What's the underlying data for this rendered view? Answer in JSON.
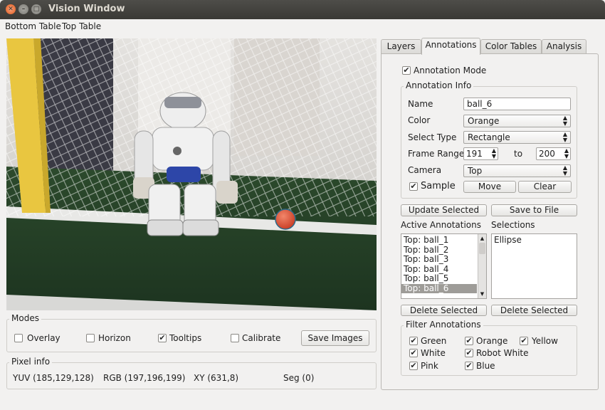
{
  "window": {
    "title": "Vision Window"
  },
  "menu": [
    "Bottom Table",
    "Top Table"
  ],
  "modes": {
    "title": "Modes",
    "overlay": "Overlay",
    "horizon": "Horizon",
    "tooltips": "Tooltips",
    "calibrate": "Calibrate",
    "save_images": "Save Images",
    "checked": {
      "overlay": false,
      "horizon": false,
      "tooltips": true,
      "calibrate": false
    }
  },
  "pixel_info": {
    "title": "Pixel info",
    "yuv": "YUV (185,129,128)",
    "rgb": "RGB (197,196,199)",
    "xy": "XY (631,8)",
    "seg": "Seg (0)"
  },
  "tabs": [
    "Layers",
    "Annotations",
    "Color Tables",
    "Analysis"
  ],
  "active_tab": "Annotations",
  "annotations": {
    "annotation_mode": "Annotation Mode",
    "annotation_mode_checked": true,
    "info_title": "Annotation Info",
    "name_label": "Name",
    "name_value": "ball_6",
    "color_label": "Color",
    "color_value": "Orange",
    "select_type_label": "Select Type",
    "select_type_value": "Rectangle",
    "frame_range_label": "Frame Range",
    "frame_from": "191",
    "frame_to_label": "to",
    "frame_to": "200",
    "camera_label": "Camera",
    "camera_value": "Top",
    "sample": "Sample",
    "sample_checked": true,
    "move": "Move",
    "clear": "Clear",
    "update_selected": "Update Selected",
    "save_to_file": "Save to File",
    "active_title": "Active Annotations",
    "selections_title": "Selections",
    "active_items": [
      "Top: ball_1",
      "Top: ball_2",
      "Top: ball_3",
      "Top: ball_4",
      "Top: ball_5",
      "Top: ball_6"
    ],
    "selected_index": 5,
    "selection_items": [
      "Ellipse"
    ],
    "delete_selected_left": "Delete Selected",
    "delete_selected_right": "Delete Selected"
  },
  "filter": {
    "title": "Filter Annotations",
    "green": "Green",
    "orange": "Orange",
    "yellow": "Yellow",
    "white": "White",
    "robot_white": "Robot White",
    "pink": "Pink",
    "blue": "Blue"
  }
}
